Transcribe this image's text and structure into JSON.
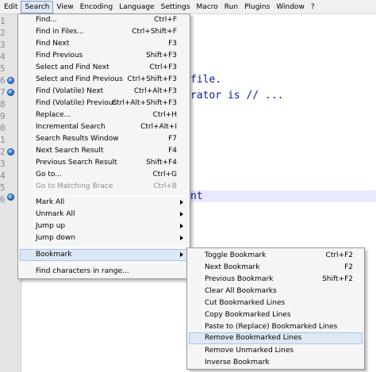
{
  "menubar": [
    "Edit",
    "Search",
    "View",
    "Encoding",
    "Language",
    "Settings",
    "Macro",
    "Run",
    "Plugins",
    "Window",
    "?"
  ],
  "gutter": {
    "lines": [
      "1",
      "2",
      "3",
      "4",
      "5",
      "6",
      "7",
      "8",
      "9",
      "0",
      "1",
      "2",
      "3",
      "4",
      "5",
      "6"
    ]
  },
  "editor": {
    "text_1": "file.",
    "text_2": "rator is // ...",
    "text_3": "nt"
  },
  "search_menu": {
    "items": [
      {
        "label": "Find...",
        "shortcut": "Ctrl+F"
      },
      {
        "label": "Find in Files...",
        "shortcut": "Ctrl+Shift+F"
      },
      {
        "label": "Find Next",
        "shortcut": "F3"
      },
      {
        "label": "Find Previous",
        "shortcut": "Shift+F3"
      },
      {
        "label": "Select and Find Next",
        "shortcut": "Ctrl+F3"
      },
      {
        "label": "Select and Find Previous",
        "shortcut": "Ctrl+Shift+F3"
      },
      {
        "label": "Find (Volatile) Next",
        "shortcut": "Ctrl+Alt+F3"
      },
      {
        "label": "Find (Volatile) Previous",
        "shortcut": "Ctrl+Alt+Shift+F3"
      },
      {
        "label": "Replace...",
        "shortcut": "Ctrl+H"
      },
      {
        "label": "Incremental Search",
        "shortcut": "Ctrl+Alt+I"
      },
      {
        "label": "Search Results Window",
        "shortcut": "F7"
      },
      {
        "label": "Next Search Result",
        "shortcut": "F4"
      },
      {
        "label": "Previous Search Result",
        "shortcut": "Shift+F4"
      },
      {
        "label": "Go to...",
        "shortcut": "Ctrl+G"
      },
      {
        "label": "Go to Matching Brace",
        "shortcut": "Ctrl+B"
      },
      {
        "label": "Mark All",
        "shortcut": ""
      },
      {
        "label": "Unmark All",
        "shortcut": ""
      },
      {
        "label": "Jump up",
        "shortcut": ""
      },
      {
        "label": "Jump down",
        "shortcut": ""
      },
      {
        "label": "Bookmark",
        "shortcut": ""
      },
      {
        "label": "Find characters in range...",
        "shortcut": ""
      }
    ]
  },
  "bookmark_menu": {
    "items": [
      {
        "label": "Toggle Bookmark",
        "shortcut": "Ctrl+F2"
      },
      {
        "label": "Next Bookmark",
        "shortcut": "F2"
      },
      {
        "label": "Previous Bookmark",
        "shortcut": "Shift+F2"
      },
      {
        "label": "Clear All Bookmarks",
        "shortcut": ""
      },
      {
        "label": "Cut Bookmarked Lines",
        "shortcut": ""
      },
      {
        "label": "Copy Bookmarked Lines",
        "shortcut": ""
      },
      {
        "label": "Paste to (Replace) Bookmarked Lines",
        "shortcut": ""
      },
      {
        "label": "Remove Bookmarked Lines",
        "shortcut": ""
      },
      {
        "label": "Remove Unmarked Lines",
        "shortcut": ""
      },
      {
        "label": "Inverse Bookmark",
        "shortcut": ""
      }
    ]
  },
  "colors": {
    "menu_bg": "#f5f5f5",
    "hover_bg": "#dde8f4",
    "code_blue": "#0a1aa0",
    "bookmark_blue": "#2f7fd6"
  }
}
